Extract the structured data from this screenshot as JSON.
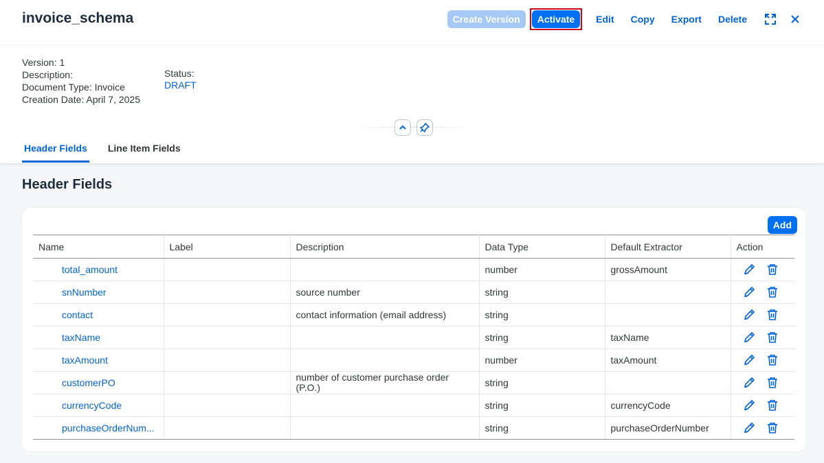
{
  "title": "invoice_schema",
  "toolbar": {
    "create_version": "Create Version",
    "activate": "Activate",
    "edit": "Edit",
    "copy": "Copy",
    "export": "Export",
    "delete": "Delete"
  },
  "meta": {
    "version": "Version: 1",
    "description": "Description:",
    "document_type": "Document Type: Invoice",
    "creation_date": "Creation Date: April 7, 2025",
    "status_label": "Status:",
    "status_value": "DRAFT"
  },
  "tabs": [
    {
      "label": "Header Fields",
      "active": true
    },
    {
      "label": "Line Item Fields",
      "active": false
    }
  ],
  "section_title": "Header Fields",
  "add_label": "Add",
  "table": {
    "columns": [
      "Name",
      "Label",
      "Description",
      "Data Type",
      "Default Extractor",
      "Action"
    ],
    "rows": [
      {
        "name": "total_amount",
        "label": "",
        "description": "",
        "data_type": "number",
        "extractor": "grossAmount"
      },
      {
        "name": "snNumber",
        "label": "",
        "description": "source number",
        "data_type": "string",
        "extractor": ""
      },
      {
        "name": "contact",
        "label": "",
        "description": "contact information (email address)",
        "data_type": "string",
        "extractor": ""
      },
      {
        "name": "taxName",
        "label": "",
        "description": "",
        "data_type": "string",
        "extractor": "taxName"
      },
      {
        "name": "taxAmount",
        "label": "",
        "description": "",
        "data_type": "number",
        "extractor": "taxAmount"
      },
      {
        "name": "customerPO",
        "label": "",
        "description": "number of customer purchase order (P.O.)",
        "data_type": "string",
        "extractor": ""
      },
      {
        "name": "currencyCode",
        "label": "",
        "description": "",
        "data_type": "string",
        "extractor": "currencyCode"
      },
      {
        "name": "purchaseOrderNum...",
        "label": "",
        "description": "",
        "data_type": "string",
        "extractor": "purchaseOrderNumber"
      }
    ]
  },
  "icons": {
    "expand": "fullscreen-icon",
    "close": "close-icon",
    "collapse": "chevron-up-icon",
    "pin": "pin-icon",
    "edit": "pencil-icon",
    "delete": "trash-icon"
  },
  "colors": {
    "accent": "#0070f2",
    "link": "#0064d9",
    "highlight_border": "#d0021b",
    "disabled_button": "#a6c8f5"
  }
}
